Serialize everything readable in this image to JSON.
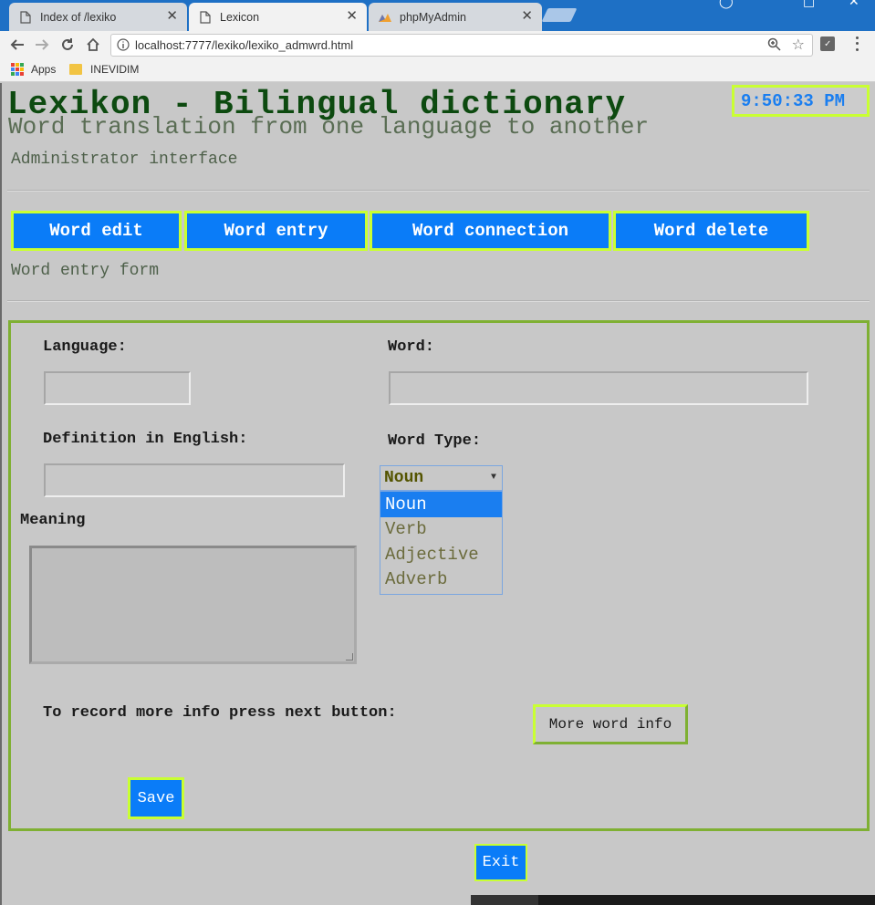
{
  "browser": {
    "tabs": [
      {
        "label": "Index of /lexiko"
      },
      {
        "label": "Lexicon"
      },
      {
        "label": "phpMyAdmin"
      }
    ],
    "url": "localhost:7777/lexiko/lexiko_admwrd.html",
    "bookmarks": [
      {
        "label": "Apps"
      },
      {
        "label": "INEVIDIM"
      }
    ]
  },
  "header": {
    "title": "Lexikon - Bilingual dictionary",
    "subtitle": "Word translation from one language to another",
    "admin_label": "Administrator interface",
    "clock": "9:50:33 PM"
  },
  "nav": {
    "word_edit": "Word edit",
    "word_entry": "Word entry",
    "word_connection": "Word connection",
    "word_delete": "Word delete"
  },
  "form": {
    "heading": "Word entry form",
    "language_label": "Language:",
    "language_value": "",
    "word_label": "Word:",
    "word_value": "",
    "definition_label": "Definition in English:",
    "definition_value": "",
    "word_type_label": "Word Type:",
    "word_type_selected": "Noun",
    "word_type_options": [
      "Noun",
      "Verb",
      "Adjective",
      "Adverb"
    ],
    "meaning_label": "Meaning",
    "meaning_value": "",
    "more_info_text": "To record more info press next button:",
    "more_info_button": "More word info",
    "save_button": "Save"
  },
  "exit_button": "Exit",
  "colors": {
    "accent_blue": "#0a7cf8",
    "highlight_lime": "#c9ff33",
    "frame_green": "#7fb033",
    "title_green": "#0d4a10"
  }
}
